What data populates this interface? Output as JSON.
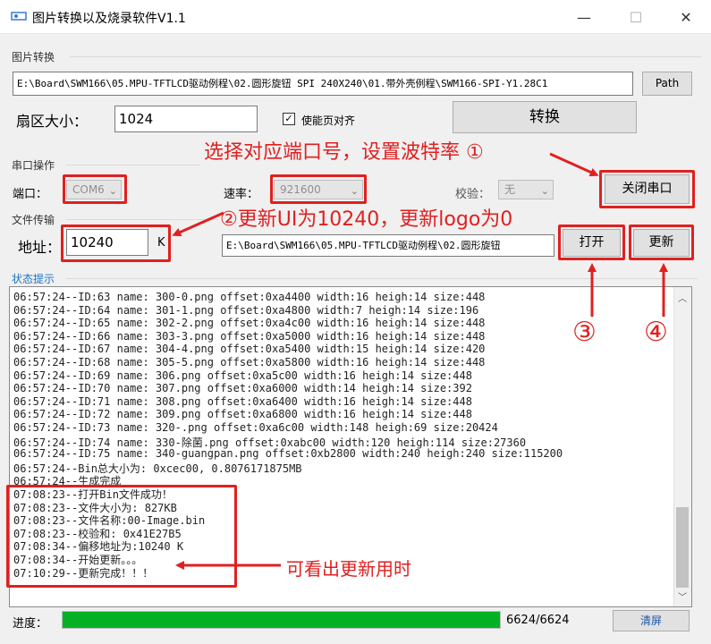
{
  "window": {
    "title": "图片转换以及烧录软件V1.1",
    "minimize": "—",
    "maximize": "☐",
    "close": "✕"
  },
  "convert_group": {
    "label": "图片转换",
    "path_value": "E:\\Board\\SWM166\\05.MPU-TFTLCD驱动例程\\02.圆形旋钮 SPI 240X240\\01.带外壳例程\\SWM166-SPI-Y1.28C1",
    "path_button": "Path",
    "sector_label": "扇区大小：",
    "sector_value": "1024",
    "page_align_label": "使能页对齐",
    "page_align_checked": true,
    "convert_button": "转换"
  },
  "serial_group": {
    "label": "串口操作",
    "port_label": "端口：",
    "port_value": "COM6",
    "baud_label": "速率：",
    "baud_value": "921600",
    "parity_label": "校验：",
    "parity_value": "无",
    "close_port_button": "关闭串口"
  },
  "transfer_group": {
    "label": "文件传输",
    "addr_label": "地址：",
    "addr_value": "10240",
    "addr_unit": "K",
    "file_path": "E:\\Board\\SWM166\\05.MPU-TFTLCD驱动例程\\02.圆形旋钮",
    "open_button": "打开",
    "update_button": "更新"
  },
  "status_group": {
    "label": "状态提示"
  },
  "log_lines": [
    "06:57:24--ID:63  name: 300-0.png  offset:0xa4400  width:16  heigh:14  size:448",
    "06:57:24--ID:64  name: 301-1.png  offset:0xa4800  width:7  heigh:14  size:196",
    "06:57:24--ID:65  name: 302-2.png  offset:0xa4c00  width:16  heigh:14  size:448",
    "06:57:24--ID:66  name: 303-3.png  offset:0xa5000  width:16  heigh:14  size:448",
    "06:57:24--ID:67  name: 304-4.png  offset:0xa5400  width:15  heigh:14  size:420",
    "06:57:24--ID:68  name: 305-5.png  offset:0xa5800  width:16  heigh:14  size:448",
    "06:57:24--ID:69  name: 306.png  offset:0xa5c00  width:16  heigh:14  size:448",
    "06:57:24--ID:70  name: 307.png  offset:0xa6000  width:14  heigh:14  size:392",
    "06:57:24--ID:71  name: 308.png  offset:0xa6400  width:16  heigh:14  size:448",
    "06:57:24--ID:72  name: 309.png  offset:0xa6800  width:16  heigh:14  size:448",
    "06:57:24--ID:73  name: 320-.png  offset:0xa6c00  width:148  heigh:69  size:20424",
    "06:57:24--ID:74  name: 330-除菌.png  offset:0xabc00  width:120  heigh:114  size:27360",
    "06:57:24--ID:75  name: 340-guangpan.png  offset:0xb2800  width:240  heigh:240  size:115200",
    "06:57:24--Bin总大小为: 0xcec00,   0.8076171875MB",
    "06:57:24--生成完成",
    "07:08:23--打开Bin文件成功！",
    "07:08:23--文件大小为: 827KB",
    "07:08:23--文件名称:00-Image.bin",
    "07:08:23--校验和: 0x41E27B5",
    "07:08:34--偏移地址为:10240  K",
    "07:08:34--开始更新。。。",
    "07:10:29--更新完成！！！"
  ],
  "progress": {
    "label": "进度：",
    "fraction": 1.0,
    "text": "6624/6624",
    "clear_button": "清屏"
  },
  "annotations": {
    "step1": "选择对应端口号，设置波特率 ①",
    "step2": "②更新UI为10240，更新logo为0",
    "step3": "③",
    "step4": "④",
    "elapsed_note": "可看出更新用时",
    "color": "#e02020"
  }
}
